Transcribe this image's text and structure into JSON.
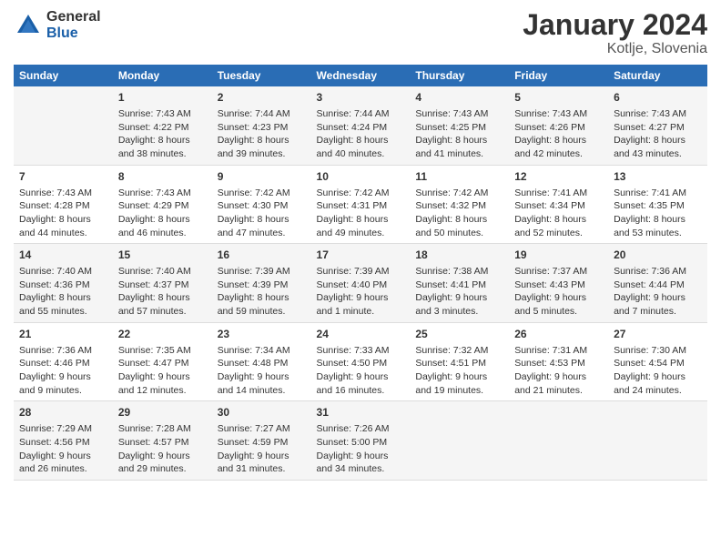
{
  "header": {
    "logo_general": "General",
    "logo_blue": "Blue",
    "title": "January 2024",
    "subtitle": "Kotlje, Slovenia"
  },
  "days_header": [
    "Sunday",
    "Monday",
    "Tuesday",
    "Wednesday",
    "Thursday",
    "Friday",
    "Saturday"
  ],
  "weeks": [
    [
      {
        "day": "",
        "content": ""
      },
      {
        "day": "1",
        "content": "Sunrise: 7:43 AM\nSunset: 4:22 PM\nDaylight: 8 hours\nand 38 minutes."
      },
      {
        "day": "2",
        "content": "Sunrise: 7:44 AM\nSunset: 4:23 PM\nDaylight: 8 hours\nand 39 minutes."
      },
      {
        "day": "3",
        "content": "Sunrise: 7:44 AM\nSunset: 4:24 PM\nDaylight: 8 hours\nand 40 minutes."
      },
      {
        "day": "4",
        "content": "Sunrise: 7:43 AM\nSunset: 4:25 PM\nDaylight: 8 hours\nand 41 minutes."
      },
      {
        "day": "5",
        "content": "Sunrise: 7:43 AM\nSunset: 4:26 PM\nDaylight: 8 hours\nand 42 minutes."
      },
      {
        "day": "6",
        "content": "Sunrise: 7:43 AM\nSunset: 4:27 PM\nDaylight: 8 hours\nand 43 minutes."
      }
    ],
    [
      {
        "day": "7",
        "content": "Sunrise: 7:43 AM\nSunset: 4:28 PM\nDaylight: 8 hours\nand 44 minutes."
      },
      {
        "day": "8",
        "content": "Sunrise: 7:43 AM\nSunset: 4:29 PM\nDaylight: 8 hours\nand 46 minutes."
      },
      {
        "day": "9",
        "content": "Sunrise: 7:42 AM\nSunset: 4:30 PM\nDaylight: 8 hours\nand 47 minutes."
      },
      {
        "day": "10",
        "content": "Sunrise: 7:42 AM\nSunset: 4:31 PM\nDaylight: 8 hours\nand 49 minutes."
      },
      {
        "day": "11",
        "content": "Sunrise: 7:42 AM\nSunset: 4:32 PM\nDaylight: 8 hours\nand 50 minutes."
      },
      {
        "day": "12",
        "content": "Sunrise: 7:41 AM\nSunset: 4:34 PM\nDaylight: 8 hours\nand 52 minutes."
      },
      {
        "day": "13",
        "content": "Sunrise: 7:41 AM\nSunset: 4:35 PM\nDaylight: 8 hours\nand 53 minutes."
      }
    ],
    [
      {
        "day": "14",
        "content": "Sunrise: 7:40 AM\nSunset: 4:36 PM\nDaylight: 8 hours\nand 55 minutes."
      },
      {
        "day": "15",
        "content": "Sunrise: 7:40 AM\nSunset: 4:37 PM\nDaylight: 8 hours\nand 57 minutes."
      },
      {
        "day": "16",
        "content": "Sunrise: 7:39 AM\nSunset: 4:39 PM\nDaylight: 8 hours\nand 59 minutes."
      },
      {
        "day": "17",
        "content": "Sunrise: 7:39 AM\nSunset: 4:40 PM\nDaylight: 9 hours\nand 1 minute."
      },
      {
        "day": "18",
        "content": "Sunrise: 7:38 AM\nSunset: 4:41 PM\nDaylight: 9 hours\nand 3 minutes."
      },
      {
        "day": "19",
        "content": "Sunrise: 7:37 AM\nSunset: 4:43 PM\nDaylight: 9 hours\nand 5 minutes."
      },
      {
        "day": "20",
        "content": "Sunrise: 7:36 AM\nSunset: 4:44 PM\nDaylight: 9 hours\nand 7 minutes."
      }
    ],
    [
      {
        "day": "21",
        "content": "Sunrise: 7:36 AM\nSunset: 4:46 PM\nDaylight: 9 hours\nand 9 minutes."
      },
      {
        "day": "22",
        "content": "Sunrise: 7:35 AM\nSunset: 4:47 PM\nDaylight: 9 hours\nand 12 minutes."
      },
      {
        "day": "23",
        "content": "Sunrise: 7:34 AM\nSunset: 4:48 PM\nDaylight: 9 hours\nand 14 minutes."
      },
      {
        "day": "24",
        "content": "Sunrise: 7:33 AM\nSunset: 4:50 PM\nDaylight: 9 hours\nand 16 minutes."
      },
      {
        "day": "25",
        "content": "Sunrise: 7:32 AM\nSunset: 4:51 PM\nDaylight: 9 hours\nand 19 minutes."
      },
      {
        "day": "26",
        "content": "Sunrise: 7:31 AM\nSunset: 4:53 PM\nDaylight: 9 hours\nand 21 minutes."
      },
      {
        "day": "27",
        "content": "Sunrise: 7:30 AM\nSunset: 4:54 PM\nDaylight: 9 hours\nand 24 minutes."
      }
    ],
    [
      {
        "day": "28",
        "content": "Sunrise: 7:29 AM\nSunset: 4:56 PM\nDaylight: 9 hours\nand 26 minutes."
      },
      {
        "day": "29",
        "content": "Sunrise: 7:28 AM\nSunset: 4:57 PM\nDaylight: 9 hours\nand 29 minutes."
      },
      {
        "day": "30",
        "content": "Sunrise: 7:27 AM\nSunset: 4:59 PM\nDaylight: 9 hours\nand 31 minutes."
      },
      {
        "day": "31",
        "content": "Sunrise: 7:26 AM\nSunset: 5:00 PM\nDaylight: 9 hours\nand 34 minutes."
      },
      {
        "day": "",
        "content": ""
      },
      {
        "day": "",
        "content": ""
      },
      {
        "day": "",
        "content": ""
      }
    ]
  ]
}
